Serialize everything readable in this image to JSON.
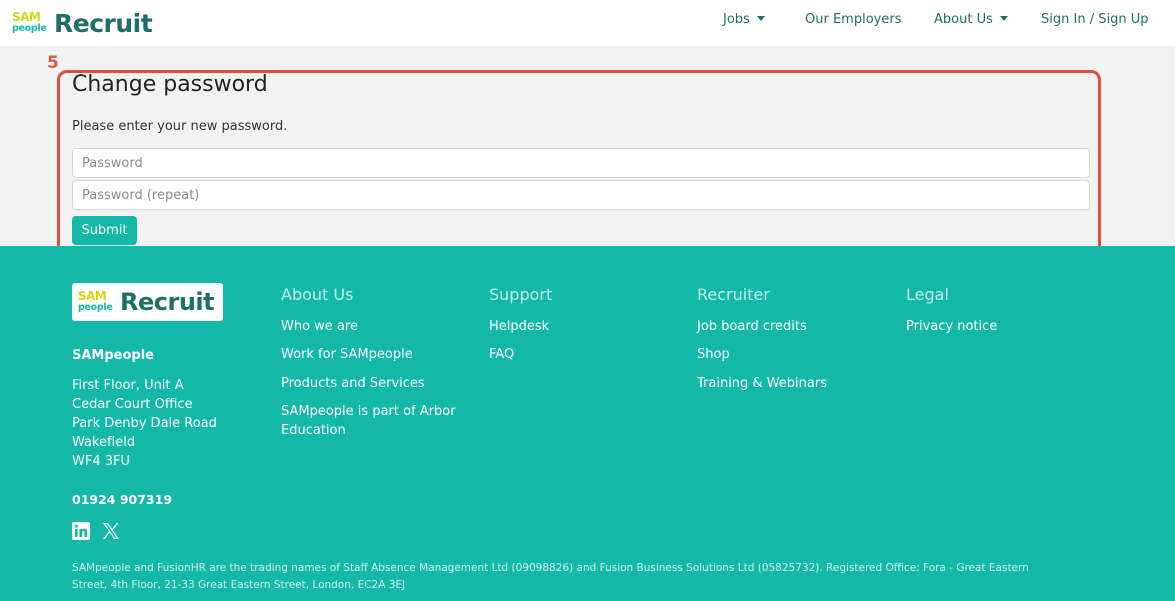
{
  "header": {
    "logo": {
      "sam": "SAM",
      "people": "people",
      "text": "Recruit"
    },
    "nav": {
      "jobs": "Jobs",
      "employers": "Our Employers",
      "about": "About Us",
      "signin": "Sign In / Sign Up"
    }
  },
  "annotation": {
    "step": "5"
  },
  "form": {
    "title": "Change password",
    "instructions": "Please enter your new password.",
    "password_placeholder": "Password",
    "password_repeat_placeholder": "Password (repeat)",
    "submit_label": "Submit"
  },
  "footer": {
    "logo": {
      "sam": "SAM",
      "people": "people",
      "text": "Recruit"
    },
    "company": {
      "name": "SAMpeople",
      "address": [
        "First Floor, Unit A",
        "Cedar Court Office",
        "Park Denby Dale Road",
        "Wakefield",
        "WF4 3FU"
      ],
      "phone": "01924 907319"
    },
    "social": [
      "linkedin-icon",
      "x-twitter-icon"
    ],
    "columns": {
      "about": {
        "heading": "About Us",
        "links": [
          "Who we are",
          "Work for SAMpeople",
          "Products and Services",
          "SAMpeople is part of Arbor",
          "Education"
        ]
      },
      "support": {
        "heading": "Support",
        "links": [
          "Helpdesk",
          "FAQ"
        ]
      },
      "recruiter": {
        "heading": "Recruiter",
        "links": [
          "Job board credits",
          "Shop",
          "Training & Webinars"
        ]
      },
      "legal": {
        "heading": "Legal",
        "links": [
          "Privacy notice"
        ]
      }
    },
    "legal_text_line1": "SAMpeople and FusionHR are the trading names of Staff Absence Management Ltd (09098826) and Fusion Business Solutions Ltd (05825732). Registered Office: Fora - Great Eastern",
    "legal_text_line2": "Street, 4th Floor, 21-33 Great Eastern Street, London, EC2A 3EJ"
  },
  "colors": {
    "teal": "#14b8a6",
    "dark_teal": "#1f6f69",
    "highlight": "#d9533b",
    "logo_yellow": "#d4d418"
  }
}
